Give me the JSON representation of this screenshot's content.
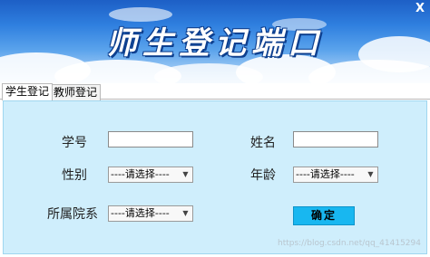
{
  "window": {
    "close_label": "X"
  },
  "banner": {
    "title": "师生登记端口"
  },
  "tabs": [
    {
      "label": "学生登记",
      "active": true
    },
    {
      "label": "教师登记",
      "active": false
    }
  ],
  "form": {
    "student_id_label": "学号",
    "student_id_value": "",
    "name_label": "姓名",
    "name_value": "",
    "gender_label": "性别",
    "gender_selected": "----请选择----",
    "age_label": "年龄",
    "age_selected": "----请选择----",
    "department_label": "所属院系",
    "department_selected": "----请选择----",
    "submit_label": "确定"
  },
  "watermark": "https://blog.csdn.net/qq_41415294",
  "colors": {
    "panel_bg": "#cfeefc",
    "button_bg": "#18b7f0",
    "banner_sky": "#2f7fdf"
  }
}
